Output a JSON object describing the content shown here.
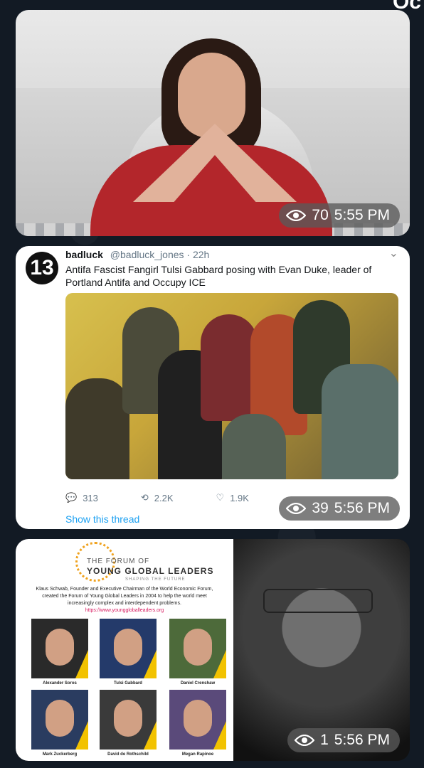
{
  "corner_fragment": "Oc",
  "messages": [
    {
      "views": "70",
      "time": "5:55 PM"
    },
    {
      "views": "39",
      "time": "5:56 PM",
      "tweet": {
        "avatar_text": "13",
        "display_name": "badluck",
        "handle": "@badluck_jones",
        "age": "· 22h",
        "text": "Antifa Fascist Fangirl Tulsi Gabbard posing with Evan Duke, leader of Portland Antifa and Occupy ICE",
        "replies": "313",
        "retweets": "2.2K",
        "likes": "1.9K",
        "show_thread": "Show this thread"
      }
    },
    {
      "views": "1",
      "time": "5:56 PM",
      "forum": {
        "title_small": "THE FORUM OF",
        "title_big": "YOUNG GLOBAL LEADERS",
        "tagline": "SHAPING THE FUTURE",
        "description": "Klaus Schwab, Founder and Executive Chairman of the World Economic Forum, created the Forum of Young Global Leaders in 2004 to help the world meet increasingly complex and interdependent problems.",
        "url": "https://www.younggloballeaders.org",
        "people": [
          "Alexander Soros",
          "Tulsi Gabbard",
          "Daniel Crenshaw",
          "Mark Zuckerberg",
          "David de Rothschild",
          "Megan Rapinoe"
        ]
      }
    }
  ]
}
